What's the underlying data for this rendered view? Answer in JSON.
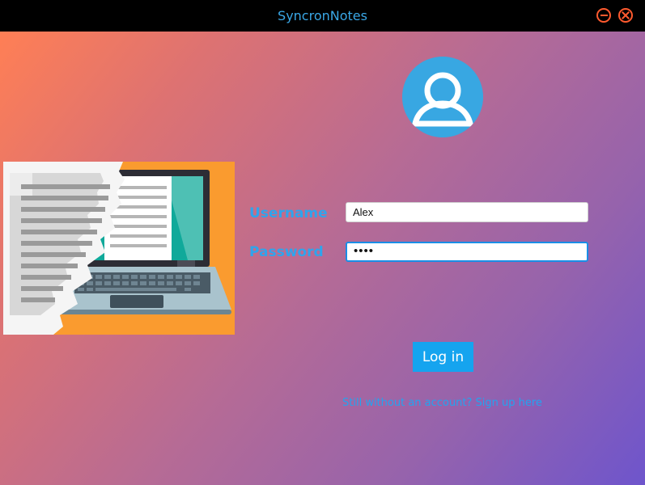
{
  "window": {
    "title": "SyncronNotes",
    "minimize_icon": "minimize-icon",
    "close_icon": "close-icon"
  },
  "colors": {
    "accent": "#15a4ef",
    "window_button": "#ff5a2e",
    "gradient_start": "#ff7f55",
    "gradient_end": "#6e55cc"
  },
  "avatar": {
    "icon": "user-icon"
  },
  "illustration": {
    "icon": "notes-laptop-illustration"
  },
  "form": {
    "username_label": "Username",
    "username_value": "Alex",
    "password_label": "Password",
    "password_mask": "••••"
  },
  "actions": {
    "login_label": "Log in",
    "signup_link": "Still without an account? Sign up here"
  }
}
